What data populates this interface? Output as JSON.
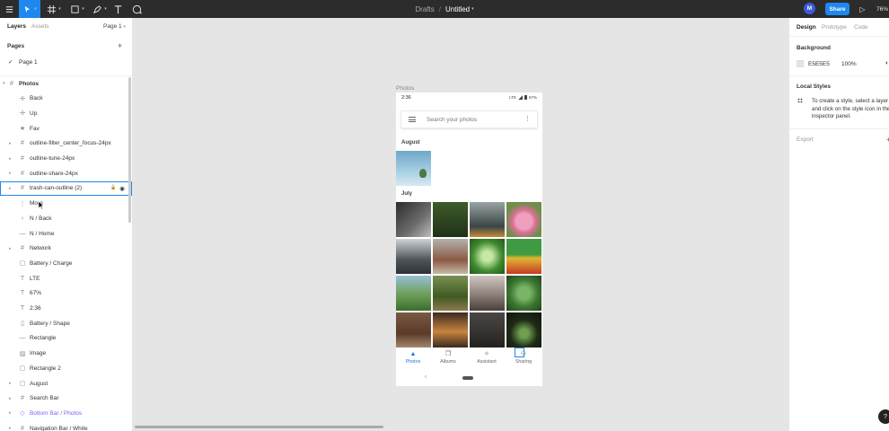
{
  "toolbar": {
    "breadcrumb_drafts": "Drafts",
    "breadcrumb_sep": "/",
    "file_name": "Untitled",
    "avatar_initial": "M",
    "share_label": "Share",
    "zoom_label": "76%"
  },
  "left_panel": {
    "tab_layers": "Layers",
    "tab_assets": "Assets",
    "page_select": "Page 1",
    "pages_heading": "Pages",
    "current_page": "Page 1",
    "layers": [
      {
        "name": "Photos",
        "icon": "frame-icon",
        "bold": true,
        "top": true,
        "chev": true
      },
      {
        "name": "Back",
        "icon": "component-icon"
      },
      {
        "name": "Up",
        "icon": "component-icon"
      },
      {
        "name": "Fav",
        "icon": "star-icon"
      },
      {
        "name": "outline-filter_center_focus-24px",
        "icon": "frame-icon",
        "chev": true
      },
      {
        "name": "outline-tune-24px",
        "icon": "frame-icon",
        "chev": true
      },
      {
        "name": "outline-share-24px",
        "icon": "frame-icon",
        "chev": true
      },
      {
        "name": "trash-can-outline (2)",
        "icon": "frame-icon",
        "chev": true,
        "selected": true
      },
      {
        "name": "More",
        "icon": "vertical-dots-icon"
      },
      {
        "name": "N / Back",
        "icon": "chevron-left-icon"
      },
      {
        "name": "N / Home",
        "icon": "minus-icon"
      },
      {
        "name": "Network",
        "icon": "frame-icon",
        "chev": true
      },
      {
        "name": "Battery / Charge",
        "icon": "rectangle-icon"
      },
      {
        "name": "LTE",
        "icon": "text-icon"
      },
      {
        "name": "67%",
        "icon": "text-icon"
      },
      {
        "name": "2:36",
        "icon": "text-icon"
      },
      {
        "name": "Battery / Shape",
        "icon": "vector-icon"
      },
      {
        "name": "Rectangle",
        "icon": "line-icon"
      },
      {
        "name": "Image",
        "icon": "image-icon"
      },
      {
        "name": "Rectangle 2",
        "icon": "rectangle-icon"
      },
      {
        "name": "August",
        "icon": "rectangle-icon",
        "chev": true
      },
      {
        "name": "Search Bar",
        "icon": "frame-icon",
        "chev": true
      },
      {
        "name": "Bottom Bar / Photos",
        "icon": "instance-icon",
        "chev": true,
        "component": true
      },
      {
        "name": "Navigation Bar / White",
        "icon": "frame-icon",
        "chev": true
      }
    ]
  },
  "canvas": {
    "frame_label": "Photos",
    "status_time": "2:36",
    "status_network": "LTE",
    "status_battery": "67%",
    "search_placeholder": "Search your photos",
    "section_august": "August",
    "section_july": "July",
    "nav": [
      {
        "label": "Photos",
        "icon": "photos-icon",
        "active": true
      },
      {
        "label": "Albums",
        "icon": "albums-icon",
        "active": false
      },
      {
        "label": "Assistant",
        "icon": "assistant-icon",
        "active": false
      },
      {
        "label": "Sharing",
        "icon": "sharing-icon",
        "active": false
      }
    ]
  },
  "right_panel": {
    "tab_design": "Design",
    "tab_prototype": "Prototype",
    "tab_code": "Code",
    "background_heading": "Background",
    "bg_hex": "E5E5E5",
    "bg_opacity": "100%",
    "local_styles_heading": "Local Styles",
    "local_styles_text": "To create a style, select a layer and click on the style icon in the inspector panel.",
    "export_heading": "Export"
  },
  "colors": {
    "accent": "#1e88f0",
    "toolbar_bg": "#2c2c2c",
    "canvas_bg": "#e5e5e5",
    "component_purple": "#7b61ff"
  }
}
